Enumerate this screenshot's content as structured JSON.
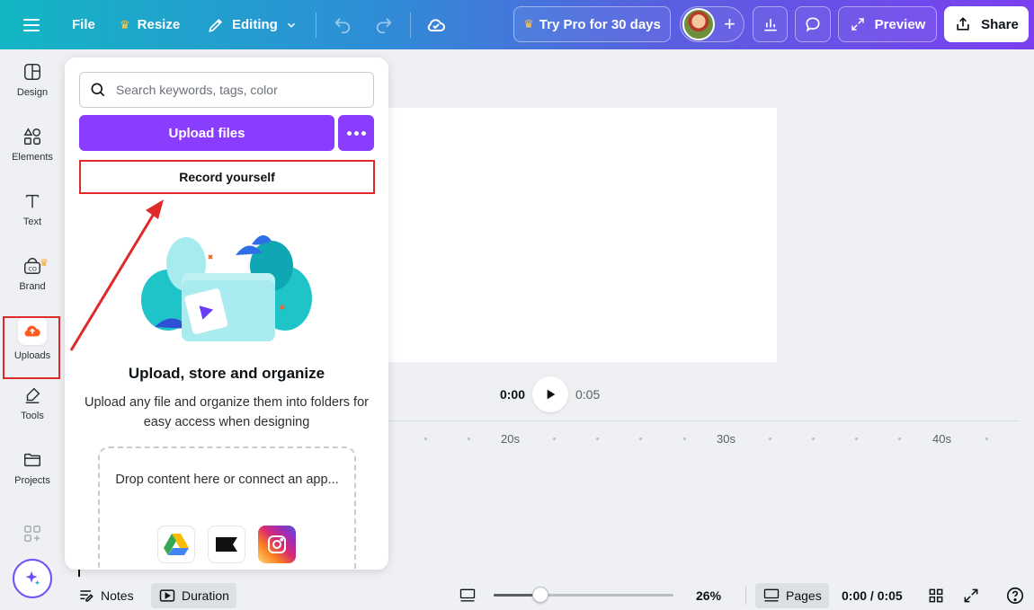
{
  "topbar": {
    "file": "File",
    "resize": "Resize",
    "editing": "Editing",
    "try_pro": "Try Pro for 30 days",
    "preview": "Preview",
    "share": "Share"
  },
  "rail": {
    "items": [
      {
        "label": "Design"
      },
      {
        "label": "Elements"
      },
      {
        "label": "Text"
      },
      {
        "label": "Brand"
      },
      {
        "label": "Uploads"
      },
      {
        "label": "Tools"
      },
      {
        "label": "Projects"
      }
    ]
  },
  "panel": {
    "search_placeholder": "Search keywords, tags, color",
    "upload_files": "Upload files",
    "record_yourself": "Record yourself",
    "title": "Upload, store and organize",
    "description": "Upload any file and organize them into folders for easy access when designing",
    "drop_text": "Drop content here or connect an app..."
  },
  "playback": {
    "current": "0:00",
    "total": "0:05"
  },
  "timeline": {
    "labels": [
      "20s",
      "30s",
      "40s"
    ]
  },
  "bottombar": {
    "notes": "Notes",
    "duration": "Duration",
    "zoom": "26%",
    "zoom_fraction": 0.26,
    "pages": "Pages",
    "time": "0:00 / 0:05"
  },
  "colors": {
    "accent": "#8b3dff",
    "annotation": "#e02a2a"
  }
}
